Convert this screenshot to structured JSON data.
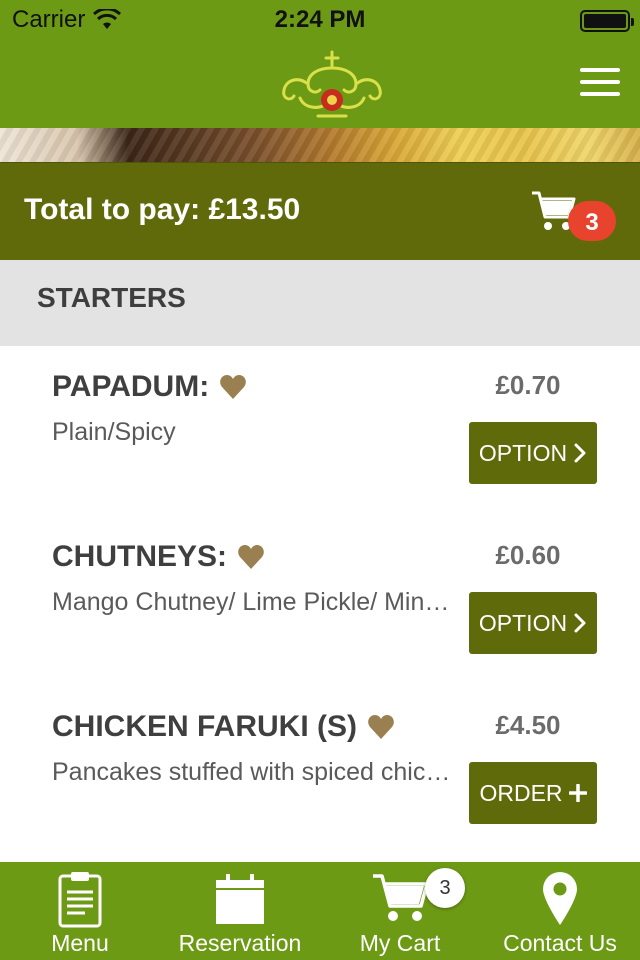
{
  "status_bar": {
    "carrier": "Carrier",
    "time": "2:24 PM",
    "battery_level": 1.0
  },
  "cart": {
    "total_label": "Total to pay: £13.50",
    "count": "3"
  },
  "section": {
    "title": "STARTERS"
  },
  "menu_items": [
    {
      "name": "PAPADUM:",
      "description": "Plain/Spicy",
      "price": "£0.70",
      "button_label": "OPTION",
      "button_icon": "chevron-right-icon"
    },
    {
      "name": "CHUTNEYS:",
      "description": "Mango Chutney/ Lime Pickle/ Mint Sauce",
      "price": "£0.60",
      "button_label": "OPTION",
      "button_icon": "chevron-right-icon"
    },
    {
      "name": "CHICKEN FARUKI (S)",
      "description": "Pancakes stuffed with spiced chicken",
      "price": "£4.50",
      "button_label": "ORDER",
      "button_icon": "plus-icon"
    }
  ],
  "tab_bar": {
    "tabs": [
      {
        "label": "Menu",
        "icon": "clipboard-icon"
      },
      {
        "label": "Reservation",
        "icon": "calendar-icon"
      },
      {
        "label": "My Cart",
        "icon": "cart-icon"
      },
      {
        "label": "Contact Us",
        "icon": "location-pin-icon"
      }
    ],
    "cart_badge": "3"
  },
  "colors": {
    "header_green": "#6d9a15",
    "total_bar_olive": "#606a0b",
    "button_olive": "#5f6b0a",
    "badge_red": "#e8432d",
    "heart_gold": "#9a8050",
    "section_grey": "#e3e3e3"
  }
}
